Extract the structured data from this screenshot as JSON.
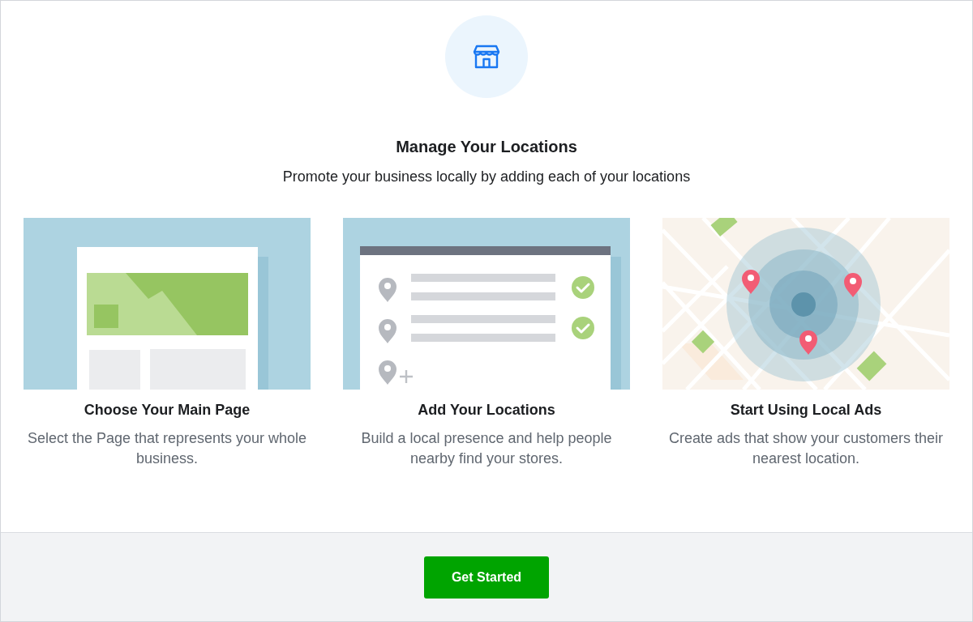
{
  "title": "Manage Your Locations",
  "subtitle": "Promote your business locally by adding each of your locations",
  "steps": [
    {
      "kind": "page",
      "title": "Choose Your Main Page",
      "description": "Select the Page that represents your whole business."
    },
    {
      "kind": "list",
      "title": "Add Your Locations",
      "description": "Build a local presence and help people nearby find your stores."
    },
    {
      "kind": "map",
      "title": "Start Using Local Ads",
      "description": "Create ads that show your customers their nearest location."
    }
  ],
  "footer": {
    "button": "Get Started"
  }
}
